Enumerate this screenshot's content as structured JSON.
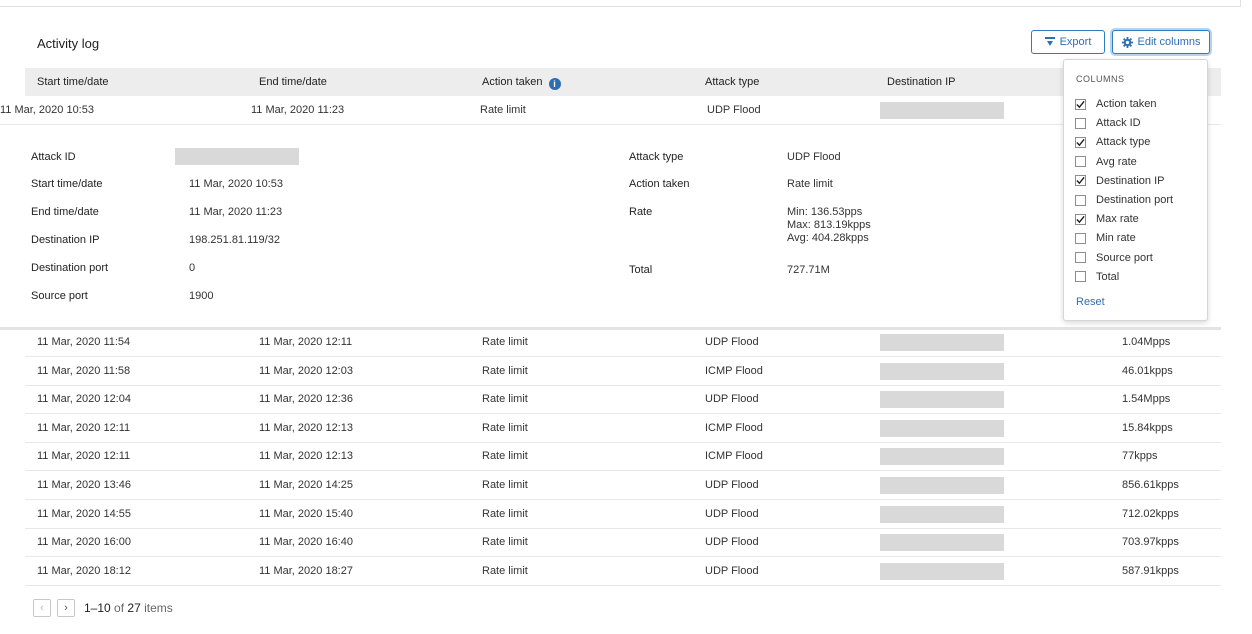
{
  "panel": {
    "title": "Activity log"
  },
  "toolbar": {
    "export_label": "Export",
    "edit_columns_label": "Edit columns"
  },
  "table": {
    "headers": [
      "Start time/date",
      "End time/date",
      "Action taken",
      "Attack type",
      "Destination IP"
    ],
    "expanded_row": {
      "start": "11 Mar, 2020 10:53",
      "end": "11 Mar, 2020 11:23",
      "action": "Rate limit",
      "attack": "UDP Flood"
    },
    "rows": [
      {
        "start": "11 Mar, 2020 11:54",
        "end": "11 Mar, 2020 12:11",
        "action": "Rate limit",
        "attack": "UDP Flood",
        "rate": "1.04Mpps"
      },
      {
        "start": "11 Mar, 2020 11:58",
        "end": "11 Mar, 2020 12:03",
        "action": "Rate limit",
        "attack": "ICMP Flood",
        "rate": "46.01kpps"
      },
      {
        "start": "11 Mar, 2020 12:04",
        "end": "11 Mar, 2020 12:36",
        "action": "Rate limit",
        "attack": "UDP Flood",
        "rate": "1.54Mpps"
      },
      {
        "start": "11 Mar, 2020 12:11",
        "end": "11 Mar, 2020 12:13",
        "action": "Rate limit",
        "attack": "ICMP Flood",
        "rate": "15.84kpps"
      },
      {
        "start": "11 Mar, 2020 12:11",
        "end": "11 Mar, 2020 12:13",
        "action": "Rate limit",
        "attack": "ICMP Flood",
        "rate": "77kpps"
      },
      {
        "start": "11 Mar, 2020 13:46",
        "end": "11 Mar, 2020 14:25",
        "action": "Rate limit",
        "attack": "UDP Flood",
        "rate": "856.61kpps"
      },
      {
        "start": "11 Mar, 2020 14:55",
        "end": "11 Mar, 2020 15:40",
        "action": "Rate limit",
        "attack": "UDP Flood",
        "rate": "712.02kpps"
      },
      {
        "start": "11 Mar, 2020 16:00",
        "end": "11 Mar, 2020 16:40",
        "action": "Rate limit",
        "attack": "UDP Flood",
        "rate": "703.97kpps"
      },
      {
        "start": "11 Mar, 2020 18:12",
        "end": "11 Mar, 2020 18:27",
        "action": "Rate limit",
        "attack": "UDP Flood",
        "rate": "587.91kpps"
      }
    ]
  },
  "details": {
    "left": [
      {
        "label": "Attack ID",
        "value": ""
      },
      {
        "label": "Start time/date",
        "value": "11 Mar, 2020 10:53"
      },
      {
        "label": "End time/date",
        "value": "11 Mar, 2020 11:23"
      },
      {
        "label": "Destination IP",
        "value": "198.251.81.119/32"
      },
      {
        "label": "Destination port",
        "value": "0"
      },
      {
        "label": "Source port",
        "value": "1900"
      }
    ],
    "right": [
      {
        "label": "Attack type",
        "value": "UDP Flood"
      },
      {
        "label": "Action taken",
        "value": "Rate limit"
      },
      {
        "label": "Rate",
        "value": "Min: 136.53pps",
        "value2": "Max: 813.19kpps",
        "value3": "Avg: 404.28kpps"
      },
      {
        "label": "Total",
        "value": "727.71M"
      }
    ]
  },
  "columns_menu": {
    "heading": "COLUMNS",
    "options": [
      {
        "label": "Action taken",
        "checked": true
      },
      {
        "label": "Attack ID",
        "checked": false
      },
      {
        "label": "Attack type",
        "checked": true
      },
      {
        "label": "Avg rate",
        "checked": false
      },
      {
        "label": "Destination IP",
        "checked": true
      },
      {
        "label": "Destination port",
        "checked": false
      },
      {
        "label": "Max rate",
        "checked": true
      },
      {
        "label": "Min rate",
        "checked": false
      },
      {
        "label": "Source port",
        "checked": false
      },
      {
        "label": "Total",
        "checked": false
      }
    ],
    "reset_label": "Reset"
  },
  "pagination": {
    "prev": "‹",
    "next": "›",
    "range": "1–10",
    "of": "of",
    "total": "27",
    "unit": "items"
  },
  "colors": {
    "accent": "#2f6fb0",
    "header_bg": "#ededed",
    "redaction": "#d9d9d9"
  }
}
